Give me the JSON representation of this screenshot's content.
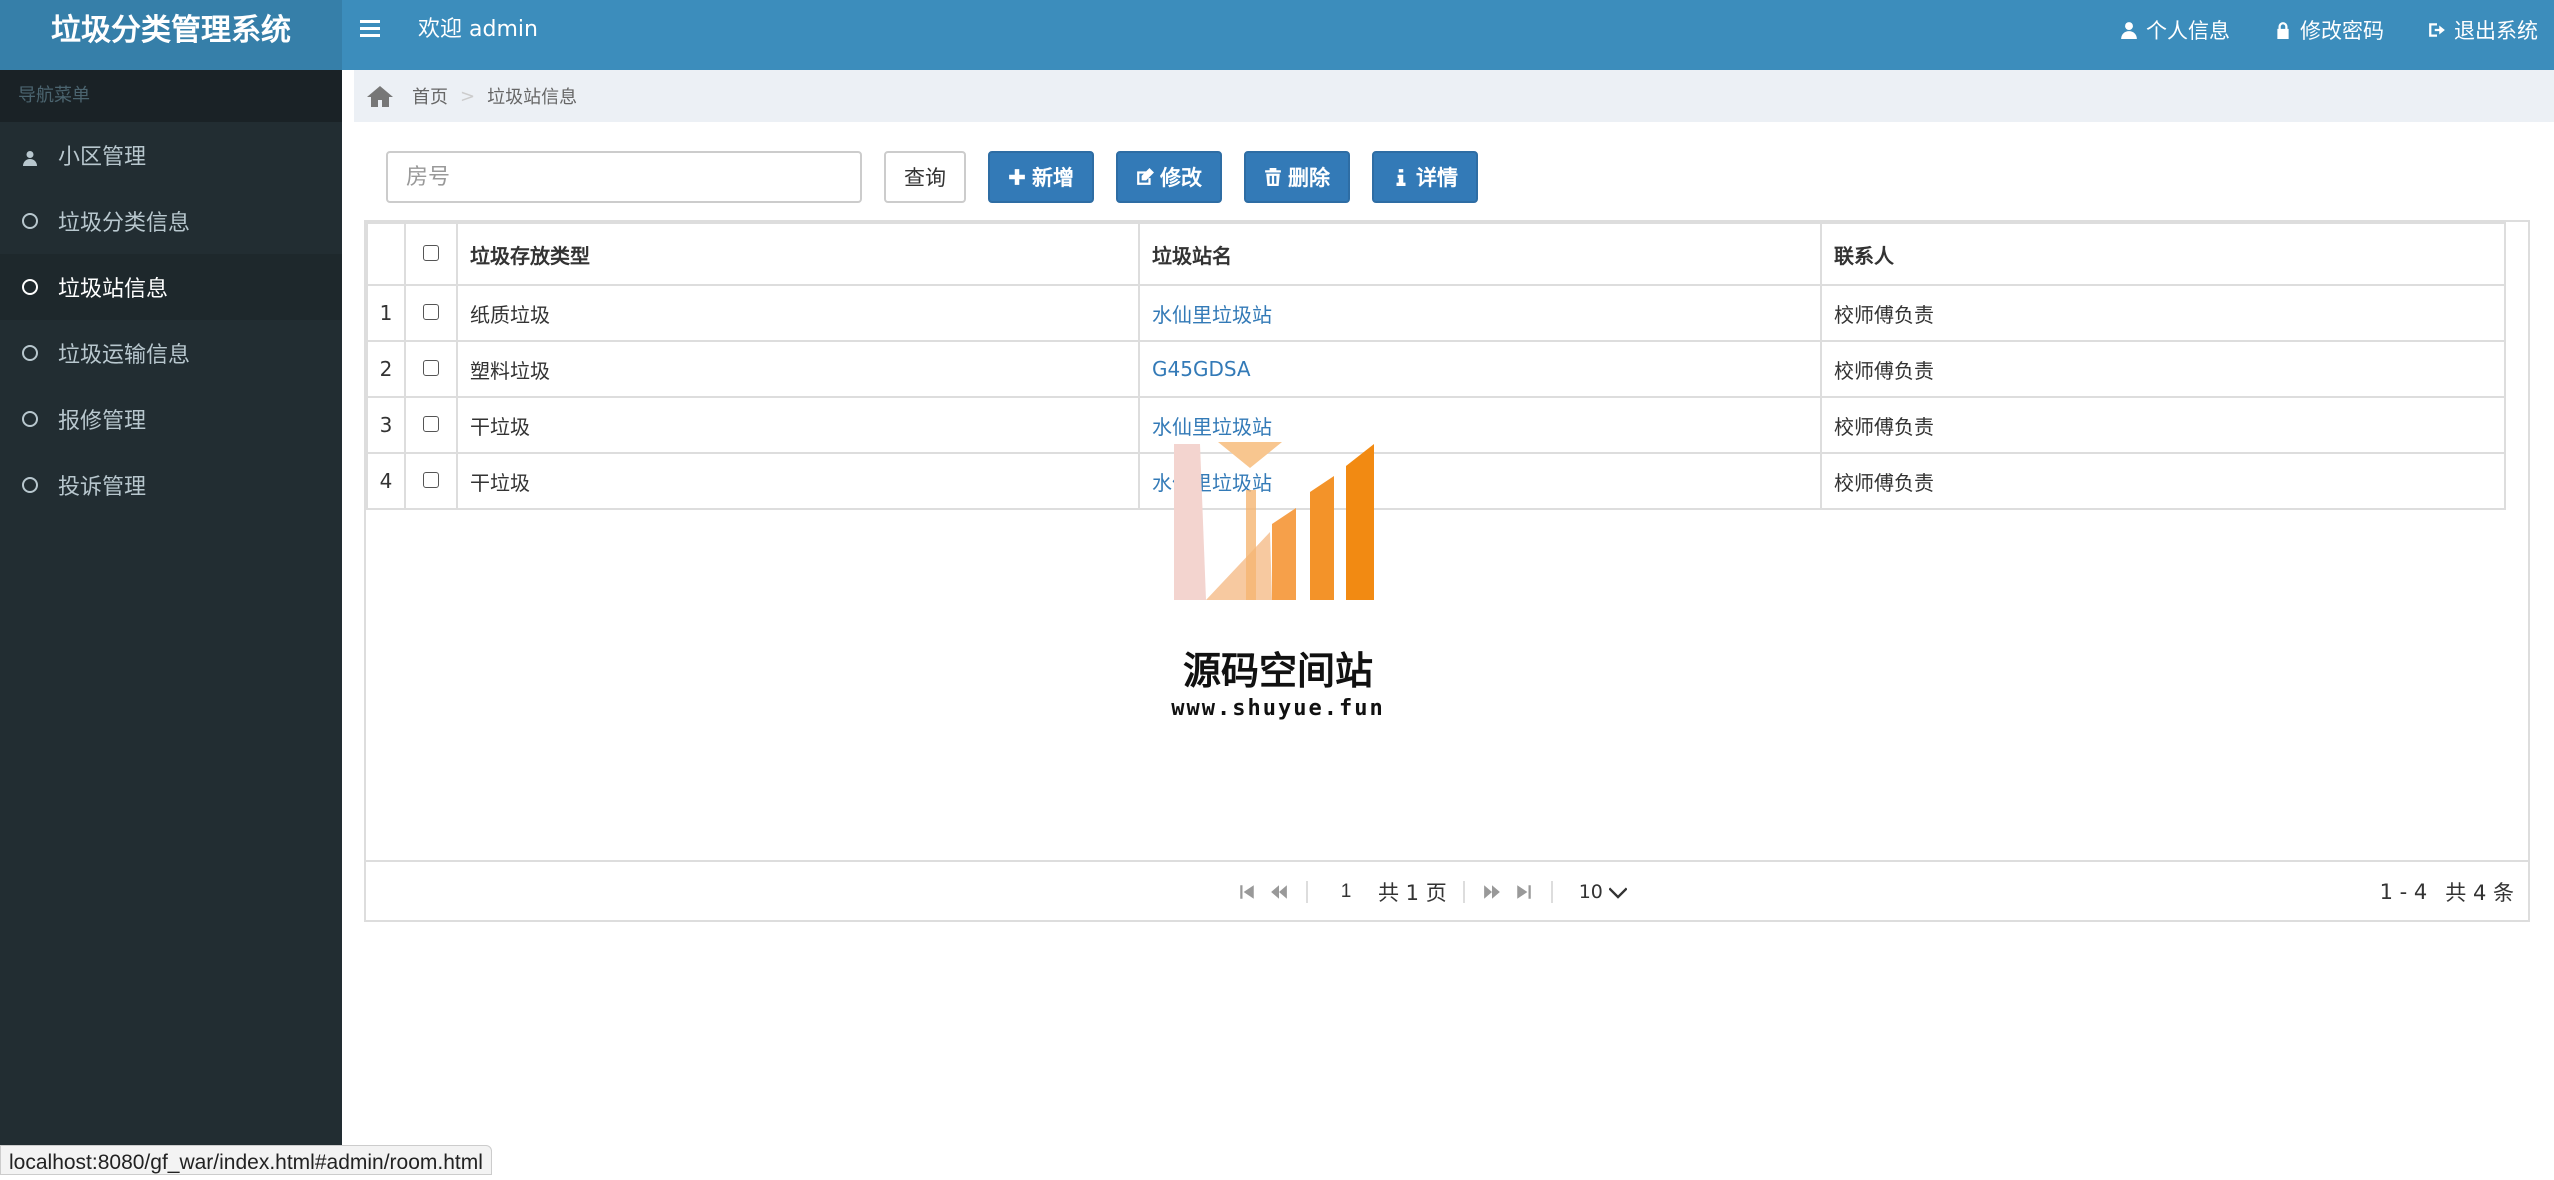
{
  "app": {
    "title": "垃圾分类管理系统",
    "welcome": "欢迎 admin"
  },
  "header_links": {
    "profile": "个人信息",
    "password": "修改密码",
    "logout": "退出系统"
  },
  "sidebar": {
    "header": "导航菜单",
    "items": [
      {
        "label": "小区管理",
        "icon": "user-icon"
      },
      {
        "label": "垃圾分类信息",
        "icon": "circle-icon"
      },
      {
        "label": "垃圾站信息",
        "icon": "circle-icon",
        "active": true
      },
      {
        "label": "垃圾运输信息",
        "icon": "circle-icon"
      },
      {
        "label": "报修管理",
        "icon": "circle-icon"
      },
      {
        "label": "投诉管理",
        "icon": "circle-icon"
      }
    ]
  },
  "breadcrumb": {
    "home": "首页",
    "current": "垃圾站信息"
  },
  "toolbar": {
    "search_placeholder": "房号",
    "query": "查询",
    "add": "新增",
    "edit": "修改",
    "delete": "删除",
    "detail": "详情"
  },
  "table": {
    "headers": [
      "垃圾存放类型",
      "垃圾站名",
      "联系人"
    ],
    "rows": [
      {
        "num": "1",
        "type": "纸质垃圾",
        "station": "水仙里垃圾站",
        "contact": "校师傅负责"
      },
      {
        "num": "2",
        "type": "塑料垃圾",
        "station": "G45GDSA",
        "contact": "校师傅负责"
      },
      {
        "num": "3",
        "type": "干垃圾",
        "station": "水仙里垃圾站",
        "contact": "校师傅负责"
      },
      {
        "num": "4",
        "type": "干垃圾",
        "station": "水仙里垃圾站",
        "contact": "校师傅负责"
      }
    ]
  },
  "pager": {
    "page": "1",
    "total_pages": "共 1 页",
    "page_size": "10",
    "range": "1 - 4",
    "total": "共 4 条"
  },
  "watermark": {
    "title": "源码空间站",
    "url": "www.shuyue.fun"
  },
  "statusbar": "localhost:8080/gf_war/index.html#admin/room.html",
  "colors": {
    "header": "#3c8dbc",
    "brand": "#367fa9",
    "sidebar": "#222d32",
    "primary": "#337ab7",
    "link": "#337ab7"
  }
}
